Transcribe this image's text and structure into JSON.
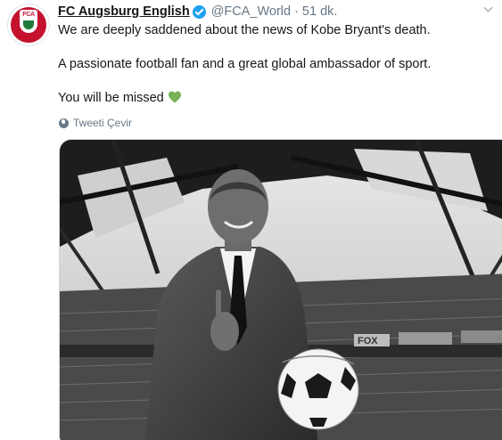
{
  "tweet": {
    "display_name": "FC Augsburg English",
    "handle": "@FCA_World",
    "separator": "·",
    "time": "51 dk.",
    "avatar_text": "FCA",
    "paragraphs": [
      "We are deeply saddened about the news of Kobe Bryant's death.",
      "A passionate football fan and a great global ambassador of sport.",
      "You will be missed"
    ],
    "emoji": "green-heart",
    "translate_label": "Tweeti Çevir",
    "verified_icon": "verified-badge-icon",
    "menu_icon": "chevron-down-icon",
    "media": {
      "description_icon": "photo",
      "stadium_sign": "FOX"
    }
  },
  "colors": {
    "link_gray": "#657786",
    "verified_blue": "#1da1f2",
    "heart_green": "#77b255",
    "club_red": "#c4122e"
  }
}
